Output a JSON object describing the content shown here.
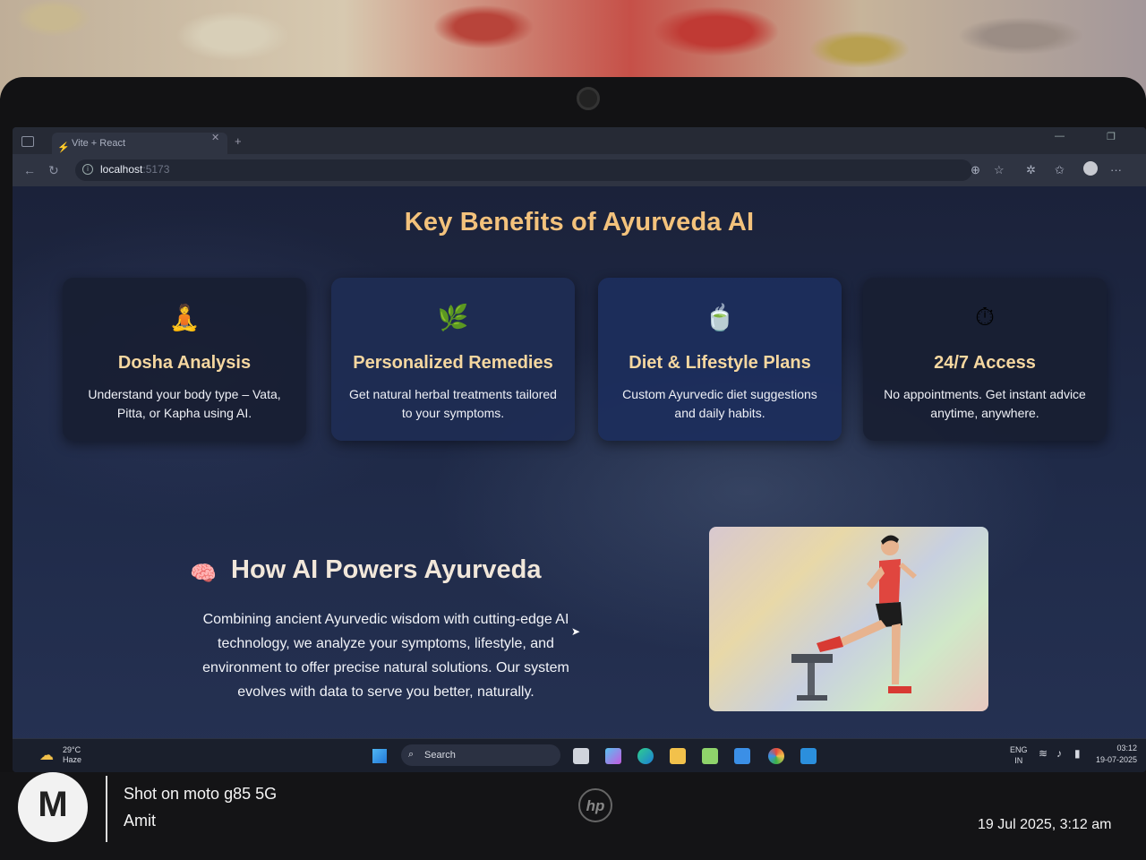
{
  "browser": {
    "tab_title": "Vite + React",
    "url_host": "localhost",
    "url_port": ":5173"
  },
  "page": {
    "heading": "Key Benefits of Ayurveda AI",
    "cards": [
      {
        "icon": "🧘",
        "title": "Dosha Analysis",
        "desc": "Understand your body type – Vata, Pitta, or Kapha using AI."
      },
      {
        "icon": "🌿",
        "title": "Personalized Remedies",
        "desc": "Get natural herbal treatments tailored to your symptoms."
      },
      {
        "icon": "🍵",
        "title": "Diet & Lifestyle Plans",
        "desc": "Custom Ayurvedic diet suggestions and daily habits."
      },
      {
        "icon": "⏱",
        "title": "24/7 Access",
        "desc": "No appointments. Get instant advice anytime, anywhere."
      }
    ],
    "ai_section": {
      "icon": "🧠",
      "title": "How AI Powers Ayurveda",
      "text": "Combining ancient Ayurvedic wisdom with cutting-edge AI technology, we analyze your symptoms, lifestyle, and environment to offer precise natural solutions. Our system evolves with data to serve you better, naturally."
    }
  },
  "taskbar": {
    "temperature": "29°C",
    "weather": "Haze",
    "search_label": "Search",
    "lang_top": "ENG",
    "lang_bottom": "IN",
    "time": "03:12",
    "date": "19-07-2025"
  },
  "photo_overlay": {
    "shot_on": "Shot on moto g85 5G",
    "author": "Amit",
    "timestamp": "19 Jul 2025, 3:12 am"
  }
}
